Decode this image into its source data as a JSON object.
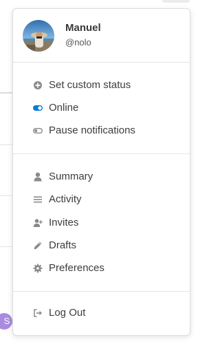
{
  "user": {
    "name": "Manuel",
    "handle": "@nolo"
  },
  "background": {
    "avatar_letter": "S",
    "avatar_color": "#a98ce0"
  },
  "status_menu": [
    {
      "label": "Set custom status",
      "icon": "plus-circle-icon"
    },
    {
      "label": "Online",
      "icon": "toggle-on-icon"
    },
    {
      "label": "Pause notifications",
      "icon": "toggle-off-icon"
    }
  ],
  "nav_menu": [
    {
      "label": "Summary",
      "icon": "user-icon"
    },
    {
      "label": "Activity",
      "icon": "list-icon"
    },
    {
      "label": "Invites",
      "icon": "user-plus-icon"
    },
    {
      "label": "Drafts",
      "icon": "pencil-icon"
    },
    {
      "label": "Preferences",
      "icon": "gear-icon"
    }
  ],
  "logout": {
    "label": "Log Out",
    "icon": "sign-out-icon"
  },
  "colors": {
    "accent": "#0a7cd1",
    "icon": "#8a8a8a",
    "text": "#3c3c3c"
  }
}
